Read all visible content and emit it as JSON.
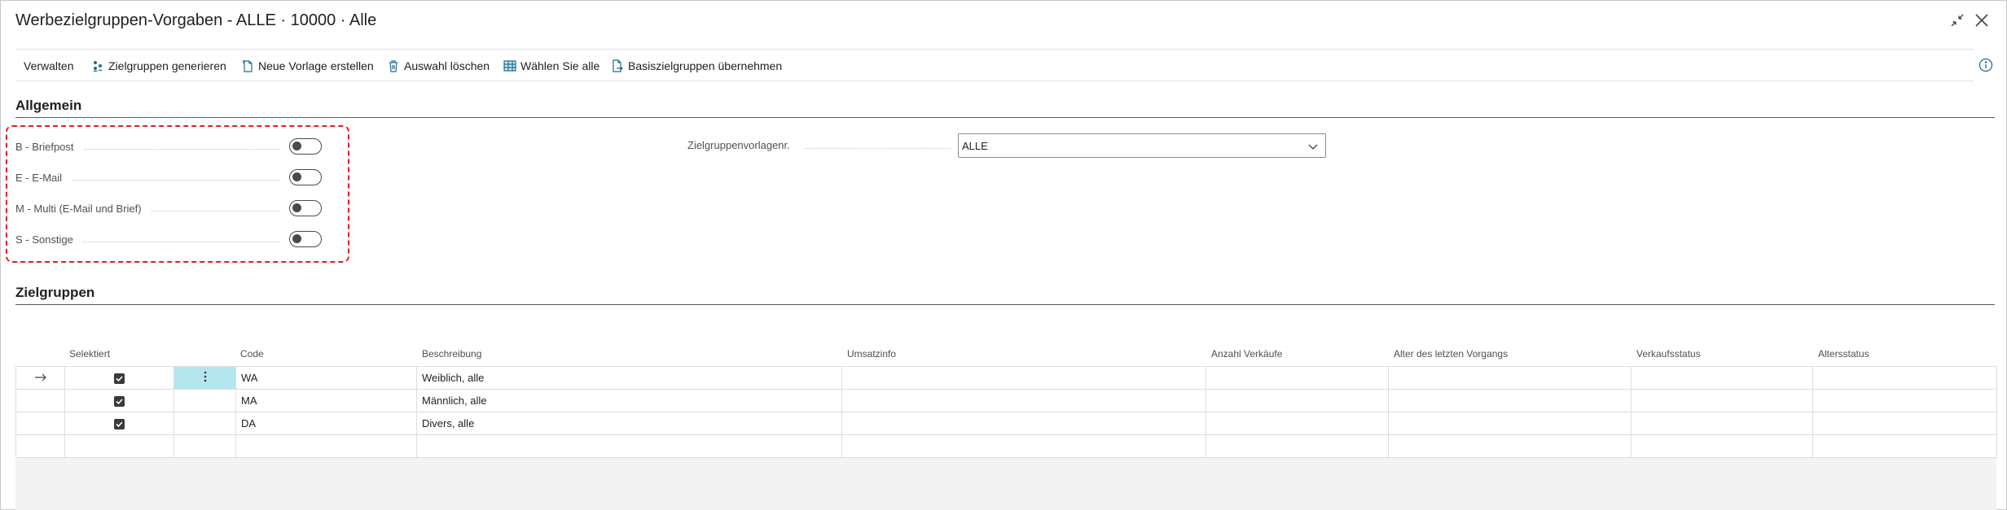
{
  "title": "Werbezielgruppen-Vorgaben - ALLE · 10000 · Alle",
  "window_controls": [
    "collapse-icon",
    "close-icon"
  ],
  "toolbar": {
    "items": [
      {
        "label": "Verwalten",
        "icon": ""
      },
      {
        "label": "Zielgruppen generieren",
        "icon": "people-icon"
      },
      {
        "label": "Neue Vorlage erstellen",
        "icon": "new-document-icon"
      },
      {
        "label": "Auswahl löschen",
        "icon": "trash-icon"
      },
      {
        "label": "Wählen Sie alle",
        "icon": "grid-icon"
      },
      {
        "label": "Basiszielgruppen übernehmen",
        "icon": "document-arrow-icon"
      }
    ],
    "info_icon": "info-icon"
  },
  "general": {
    "title": "Allgemein",
    "toggles": [
      {
        "label": "B - Briefpost",
        "on": false
      },
      {
        "label": "E - E-Mail",
        "on": false
      },
      {
        "label": "M - Multi (E-Mail und Brief)",
        "on": false
      },
      {
        "label": "S - Sonstige",
        "on": false
      }
    ],
    "template_field": {
      "label": "Zielgruppenvorlagenr.",
      "value": "ALLE"
    }
  },
  "groups": {
    "title": "Zielgruppen",
    "columns": [
      "Selektiert",
      "Code",
      "Beschreibung",
      "Umsatzinfo",
      "Anzahl Verkäufe",
      "Alter des letzten Vorgangs",
      "Verkaufsstatus",
      "Altersstatus"
    ],
    "rows": [
      {
        "selected": true,
        "code": "WA",
        "description": "Weiblich, alle",
        "current": true
      },
      {
        "selected": true,
        "code": "MA",
        "description": "Männlich, alle",
        "current": false
      },
      {
        "selected": true,
        "code": "DA",
        "description": "Divers, alle",
        "current": false
      }
    ],
    "colors": {
      "active_cell": "#b4e6ee",
      "accent": "#1e6e8c",
      "focus_outline": "#e02020"
    }
  }
}
